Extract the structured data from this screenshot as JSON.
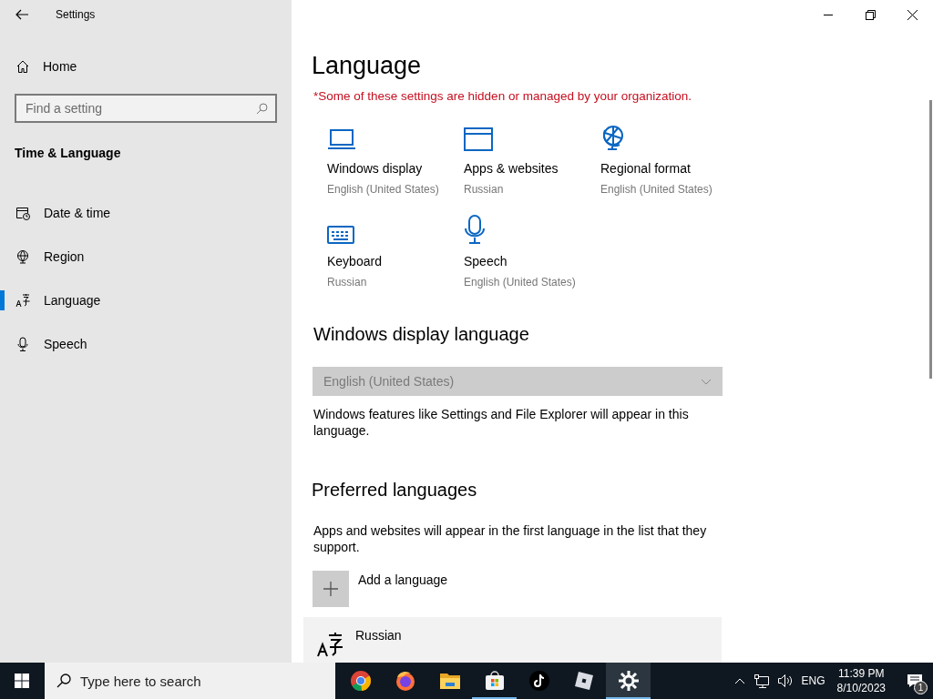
{
  "window": {
    "title": "Settings"
  },
  "sidebar": {
    "home": "Home",
    "search": {
      "placeholder": "Find a setting"
    },
    "section": "Time & Language",
    "items": [
      {
        "label": "Date & time",
        "kind": "calendar",
        "selected": false
      },
      {
        "label": "Region",
        "kind": "globe",
        "selected": false
      },
      {
        "label": "Language",
        "kind": "language",
        "selected": true
      },
      {
        "label": "Speech",
        "kind": "mic",
        "selected": false
      }
    ]
  },
  "page": {
    "title": "Language",
    "notice": "*Some of these settings are hidden or managed by your organization.",
    "tiles": [
      {
        "kind": "laptop",
        "label": "Windows display",
        "value": "English (United States)"
      },
      {
        "kind": "window",
        "label": "Apps & websites",
        "value": "Russian"
      },
      {
        "kind": "globe",
        "label": "Regional format",
        "value": "English (United States)"
      },
      {
        "kind": "keyboard",
        "label": "Keyboard",
        "value": "Russian"
      },
      {
        "kind": "mic",
        "label": "Speech",
        "value": "English (United States)"
      }
    ],
    "display_language": {
      "heading": "Windows display language",
      "dropdown": {
        "value": "English (United States)",
        "disabled": true
      },
      "description": "Windows features like Settings and File Explorer will appear in this language."
    },
    "preferred": {
      "heading": "Preferred languages",
      "description": "Apps and websites will appear in the first language in the list that they support.",
      "add_button": "Add a language",
      "languages": [
        {
          "name": "Russian"
        }
      ]
    }
  },
  "taskbar": {
    "search": {
      "placeholder": "Type here to search"
    },
    "apps": [
      {
        "kind": "chrome",
        "running": false,
        "selected": false
      },
      {
        "kind": "firefox",
        "running": false,
        "selected": false
      },
      {
        "kind": "folder",
        "running": false,
        "selected": false
      },
      {
        "kind": "store",
        "running": true,
        "selected": false
      },
      {
        "kind": "tiktok",
        "running": false,
        "selected": false
      },
      {
        "kind": "roblox",
        "running": false,
        "selected": false
      },
      {
        "kind": "gear",
        "running": true,
        "selected": true
      }
    ],
    "tray": {
      "language": "ENG",
      "time": "11:39 PM",
      "date": "8/10/2023",
      "notification_count": "1"
    }
  }
}
